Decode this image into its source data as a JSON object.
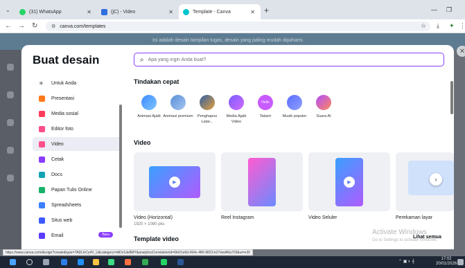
{
  "browser": {
    "tabs": [
      {
        "label": "(31) WhatsApp",
        "icon": "whatsapp-icon",
        "color": "#25d366"
      },
      {
        "label": "(jC) - Video",
        "icon": "video-icon",
        "color": "#2f6fde"
      },
      {
        "label": "Template - Canva",
        "icon": "canva-icon",
        "color": "#00c4cc"
      }
    ],
    "url": "canva.com/templates",
    "status_url": "https://www.canva.com/design?create&type=TADiJvCy4V_U&category=tADv1de8MY&analyticsCorrelationId=6fe01e6d-004c-4f6f-9823-b27ebd40a703&ui=e30"
  },
  "background": {
    "banner_text": "Ini adalah desain tampilan tugas, desain yang paling mudah dipahami."
  },
  "modal": {
    "title": "Buat desain",
    "search_placeholder": "Apa yang ingin Anda buat?",
    "sidebar": [
      {
        "label": "Untuk Anda",
        "icon": "sparkle-icon",
        "color": "#333333"
      },
      {
        "label": "Presentasi",
        "icon": "presentation-icon",
        "color": "#ff7a1a"
      },
      {
        "label": "Media sosial",
        "icon": "heart-icon",
        "color": "#ff3b5c"
      },
      {
        "label": "Editor foto",
        "icon": "camera-icon",
        "color": "#ff4f8b"
      },
      {
        "label": "Video",
        "icon": "video-icon",
        "color": "#ff4f8b",
        "selected": true
      },
      {
        "label": "Cetak",
        "icon": "print-icon",
        "color": "#8b3dff"
      },
      {
        "label": "Docs",
        "icon": "docs-icon",
        "color": "#13a3b5"
      },
      {
        "label": "Papan Tulis Online",
        "icon": "whiteboard-icon",
        "color": "#17b26a"
      },
      {
        "label": "Spreadsheets",
        "icon": "spreadsheet-icon",
        "color": "#3d7fff"
      },
      {
        "label": "Situs web",
        "icon": "website-icon",
        "color": "#3d5bff"
      },
      {
        "label": "Email",
        "icon": "email-icon",
        "color": "#5a3dff",
        "badge": "Baru"
      }
    ],
    "quick_actions_title": "Tindakan cepat",
    "quick_actions": [
      {
        "label": "Animasi Ajaib",
        "icon": "magic-animate-icon",
        "color": "#3d8bff"
      },
      {
        "label": "Animasi premium",
        "icon": "premium-animation-icon",
        "color": "#5a8fd8"
      },
      {
        "label": "Penghapus Latar...",
        "icon": "background-remover-icon",
        "color": "#e8a13a"
      },
      {
        "label": "Media Ajaib Video",
        "icon": "magic-media-icon",
        "color": "#7a5cff"
      },
      {
        "label": "Takarir",
        "icon": "captions-icon",
        "color": "#c85bff",
        "pill": "Hello"
      },
      {
        "label": "Musik populer",
        "icon": "music-icon",
        "color": "#5a6cff"
      },
      {
        "label": "Suara AI",
        "icon": "ai-voice-icon",
        "color": "#b04bff"
      }
    ],
    "video_title": "Video",
    "video_cards": [
      {
        "label": "Video (Horizontal)",
        "sub": "1920 × 1080 pks"
      },
      {
        "label": "Reel Instagram",
        "sub": ""
      },
      {
        "label": "Video Seluler",
        "sub": ""
      },
      {
        "label": "Perekaman layar",
        "sub": ""
      }
    ],
    "template_video_title": "Template video",
    "see_all": "Lihat semua"
  },
  "windows_watermark": {
    "line1": "Activate Windows",
    "line2": "Go to Settings to activate Windows."
  },
  "taskbar": {
    "time": "17:02",
    "date": "20/01/2026"
  }
}
